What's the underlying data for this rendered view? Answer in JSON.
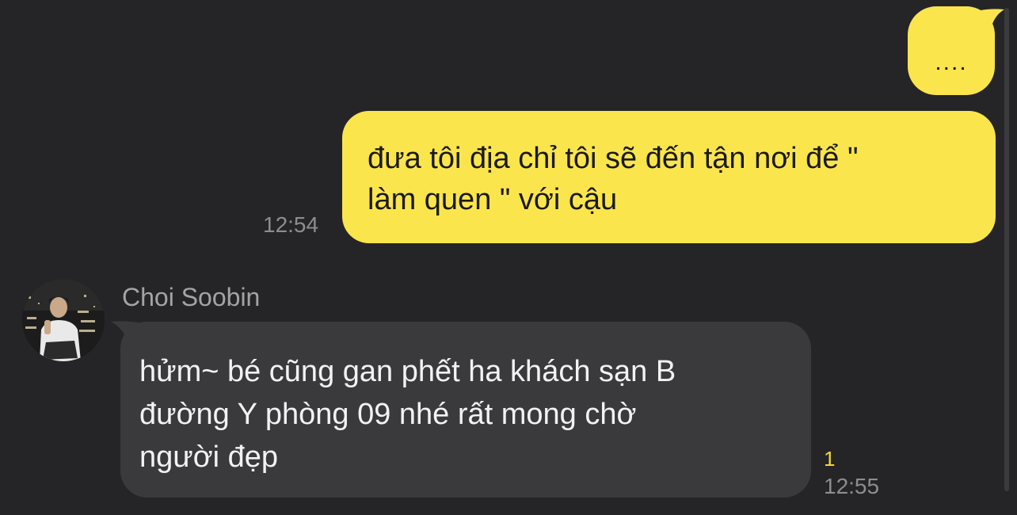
{
  "colors": {
    "background": "#252527",
    "sent_bubble": "#fbe54d",
    "received_bubble": "#3a3a3c",
    "timestamp": "#8d8d91",
    "unread_count": "#f5d63c"
  },
  "messages": [
    {
      "direction": "sent",
      "text": "....",
      "time": ""
    },
    {
      "direction": "sent",
      "text": "đưa tôi địa chỉ tôi sẽ đến tận nơi để \"\nlàm quen \" với cậu",
      "time": "12:54"
    },
    {
      "direction": "received",
      "sender": "Choi Soobin",
      "avatar_icon": "profile-photo",
      "text": "hửm~ bé cũng gan phết ha khách sạn B\nđường Y phòng 09 nhé rất mong chờ\nngười đẹp",
      "unread": "1",
      "time": "12:55"
    }
  ]
}
